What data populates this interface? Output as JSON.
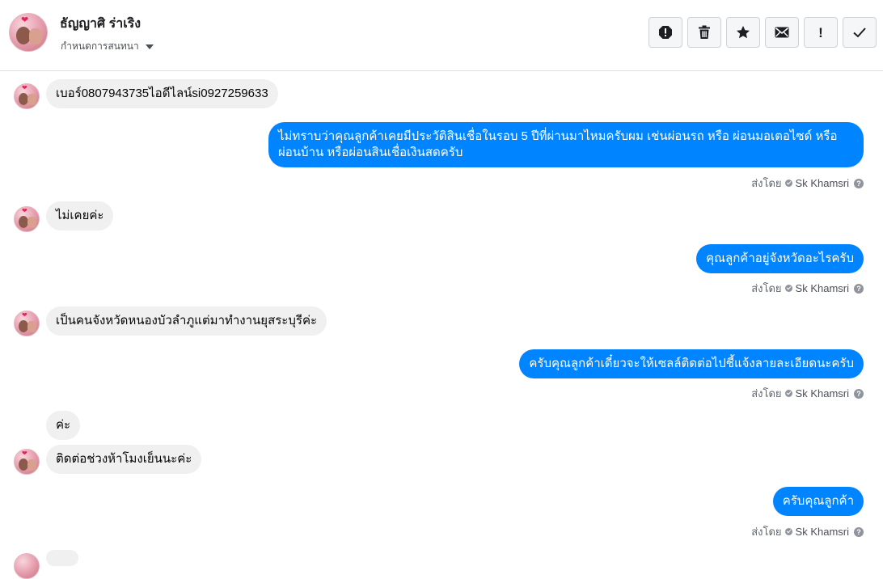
{
  "header": {
    "contact_name": "ธัญญาศิ ร่าเริง",
    "assign_label": "กำหนดการสนทนา",
    "actions": [
      "spam-icon",
      "trash-icon",
      "star-icon",
      "envelope-icon",
      "exclamation-icon",
      "check-icon"
    ],
    "exclamation_glyph": "!"
  },
  "messages": [
    {
      "direction": "in",
      "text": "เบอร์0807943735ไอดีไลน์si0927259633"
    },
    {
      "direction": "out",
      "text": "ไม่ทราบว่าคุณลูกค้าเคยมีประวัติสินเชื่อในรอบ 5 ปีที่ผ่านมาไหมครับผม เช่นผ่อนรถ หรือ ผ่อนมอเตอไซด์ หรือ ผ่อนบ้าน หรือผ่อนสินเชื่อเงินสดครับ",
      "sent_by_label": "ส่งโดย",
      "sender": "Sk Khamsri"
    },
    {
      "direction": "in",
      "text": "ไม่เคยค่ะ"
    },
    {
      "direction": "out",
      "text": "คุณลูกค้าอยู่จังหวัดอะไรครับ",
      "sent_by_label": "ส่งโดย",
      "sender": "Sk Khamsri"
    },
    {
      "direction": "in",
      "text": "เป็นคนจังหวัดหนองบัวลำภูแต่มาทำงานยุสระบุรีค่ะ"
    },
    {
      "direction": "out",
      "text": "ครับคุณลูกค้าเดี๋ยวจะให้เซลล์ติดต่อไปชี้แจ้งลายละเอียดนะครับ",
      "sent_by_label": "ส่งโดย",
      "sender": "Sk Khamsri"
    },
    {
      "direction": "in",
      "text": "ค่ะ"
    },
    {
      "direction": "in",
      "text": "ติดต่อช่วงห้าโมงเย็นนะค่ะ"
    },
    {
      "direction": "out",
      "text": "ครับคุณลูกค้า",
      "sent_by_label": "ส่งโดย",
      "sender": "Sk Khamsri"
    }
  ],
  "colors": {
    "outgoing_bubble": "#0084ff",
    "incoming_bubble": "#f0f0f0"
  }
}
